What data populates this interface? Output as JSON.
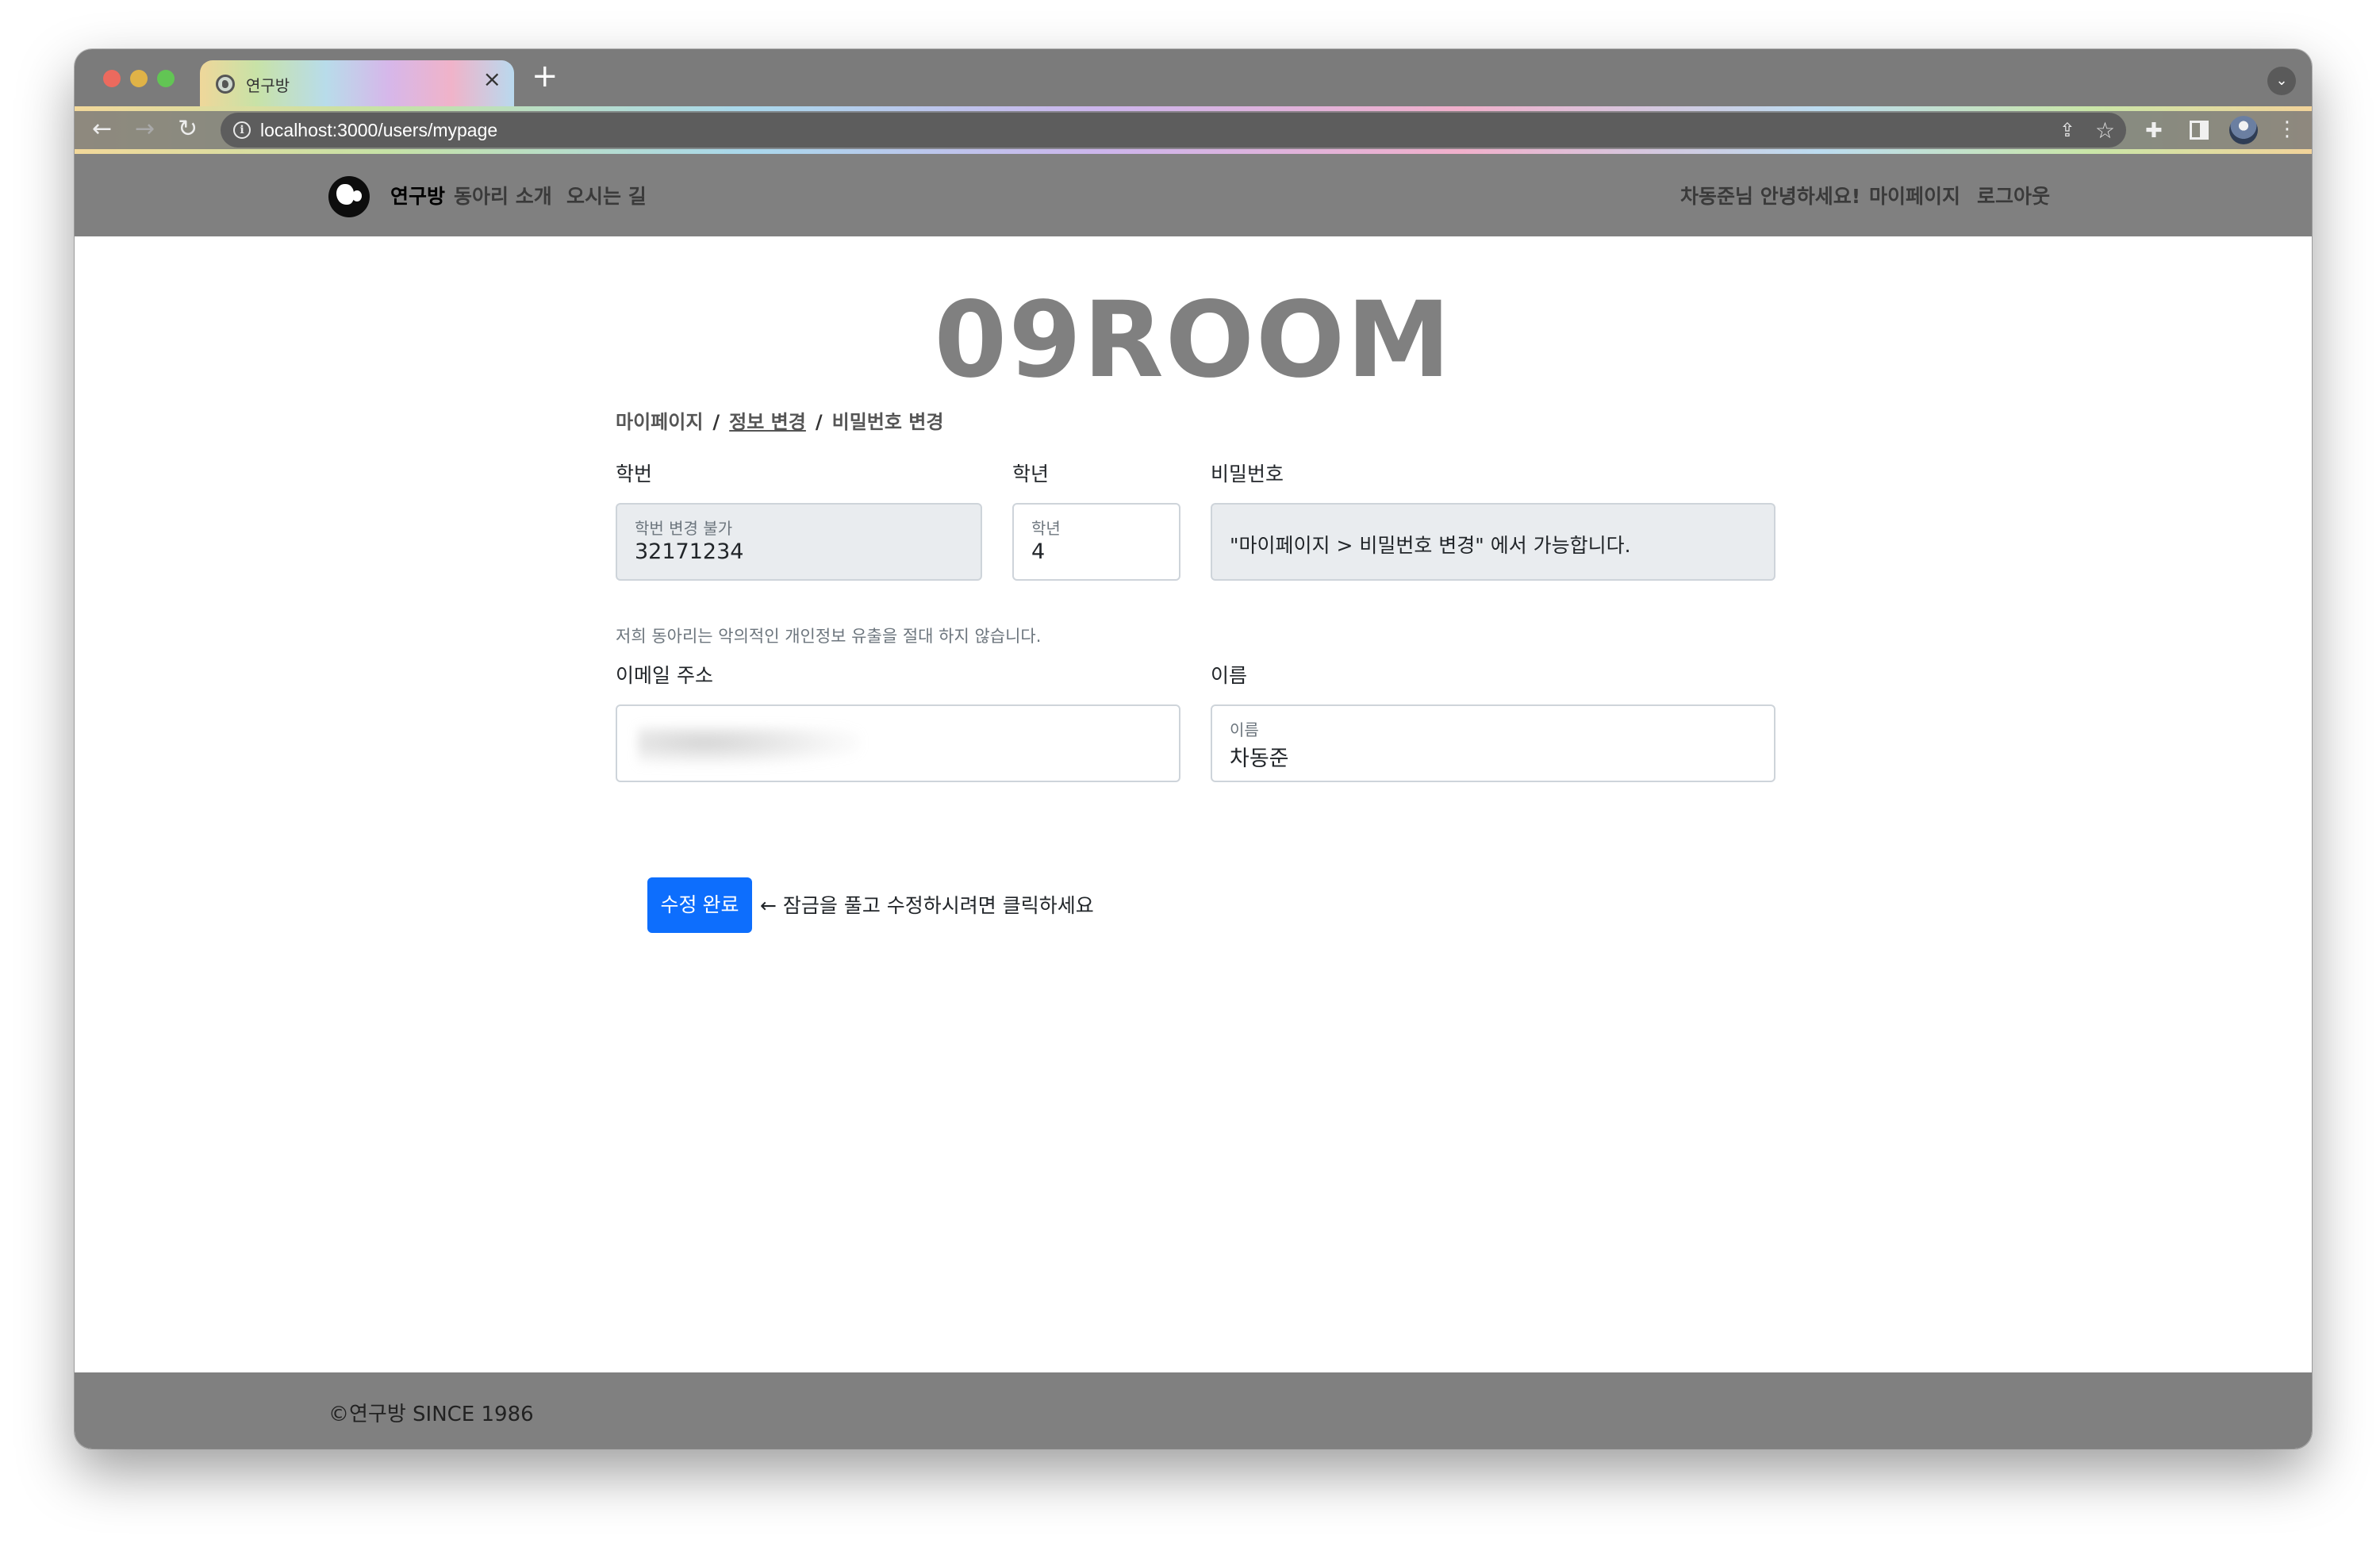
{
  "browser": {
    "tab_title": "연구방",
    "tab_close": "×",
    "new_tab": "+",
    "tab_list": "⌄",
    "url": "localhost:3000/users/mypage",
    "icons": {
      "back": "←",
      "forward": "→",
      "reload": "↻",
      "info": "i",
      "share": "⇪",
      "bookmark": "☆",
      "extensions": "✚",
      "menu": "⋮"
    }
  },
  "site_nav": {
    "brand": "연구방",
    "links": [
      "동아리 소개",
      "오시는 길"
    ],
    "greeting": "차동준님 안녕하세요!",
    "mypage": "마이페이지",
    "logout": "로그아웃"
  },
  "hero": {
    "title": "09ROOM"
  },
  "breadcrumb": {
    "items": [
      "마이페이지",
      "정보 변경",
      "비밀번호 변경"
    ],
    "separator": "/"
  },
  "form": {
    "student_id": {
      "label": "학번",
      "floating_label": "학번 변경 불가",
      "value": "32171234"
    },
    "grade": {
      "label": "학년",
      "floating_label": "학년",
      "value": "4"
    },
    "password": {
      "label": "비밀번호",
      "note": "\"마이페이지 > 비밀번호 변경\" 에서 가능합니다."
    },
    "privacy_note": "저희 동아리는 악의적인 개인정보 유출을 절대 하지 않습니다.",
    "email": {
      "label": "이메일 주소",
      "value": ""
    },
    "name": {
      "label": "이름",
      "floating_label": "이름",
      "value": "차동준"
    },
    "submit_label": "수정 완료",
    "hint": "← 잠금을 풀고 수정하시려면 클릭하세요"
  },
  "footer": {
    "text": "©연구방 SINCE 1986"
  },
  "colors": {
    "nav_bg": "#808080",
    "primary_button": "#0d6efd",
    "disabled_input": "#e9ecef"
  }
}
